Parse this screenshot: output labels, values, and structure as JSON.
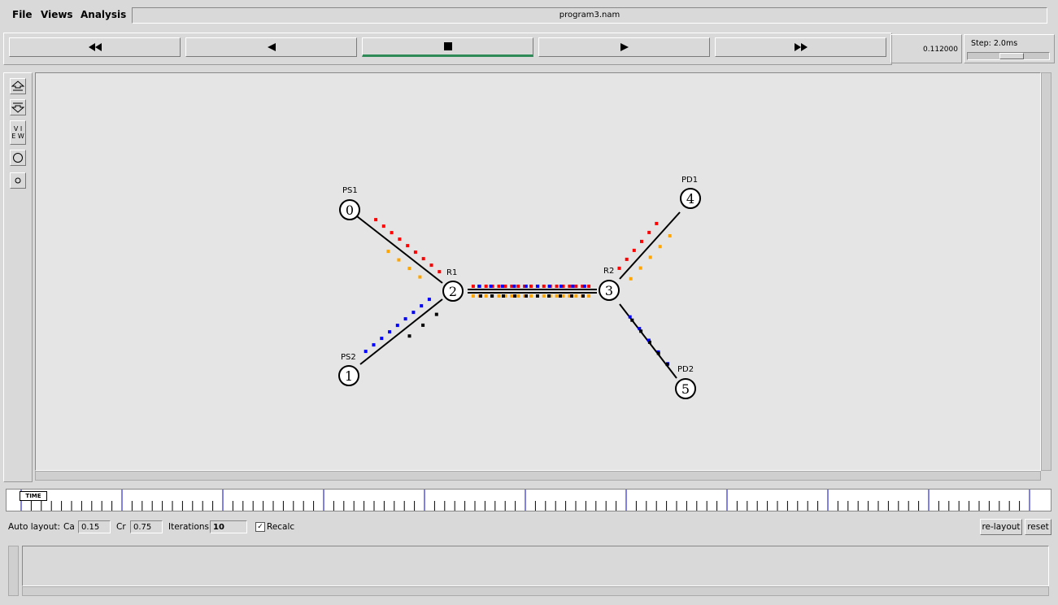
{
  "menu": {
    "file": "File",
    "views": "Views",
    "analysis": "Analysis"
  },
  "window_title": "program3.nam",
  "playback": {
    "buttons": [
      {
        "name": "fast-rewind",
        "icon": "double-left-triangle-icon"
      },
      {
        "name": "rewind",
        "icon": "left-triangle-icon"
      },
      {
        "name": "stop",
        "icon": "square-stop-icon",
        "active": true
      },
      {
        "name": "play",
        "icon": "right-triangle-icon"
      },
      {
        "name": "fast-forward",
        "icon": "double-right-triangle-icon"
      }
    ],
    "time": "0.112000",
    "step_label": "Step: 2.0ms"
  },
  "toolbar": {
    "view_label_1": "V I",
    "view_label_2": "E W"
  },
  "nodes": [
    {
      "id": "0",
      "label": "PS1"
    },
    {
      "id": "1",
      "label": "PS2"
    },
    {
      "id": "2",
      "label": "R1"
    },
    {
      "id": "3",
      "label": "R2"
    },
    {
      "id": "4",
      "label": "PD1"
    },
    {
      "id": "5",
      "label": "PD2"
    }
  ],
  "colors": {
    "red": "#ff0000",
    "orange": "#ffa500",
    "blue": "#0000ff",
    "black": "#000000",
    "active_bar": "#2e8b57",
    "canvas": "#e5e5e5"
  },
  "timeline": {
    "tag": "TIME"
  },
  "autolayout": {
    "label": "Auto layout:",
    "ca_label": "Ca",
    "ca_value": "0.15",
    "cr_label": "Cr",
    "cr_value": "0.75",
    "iterations_label": "Iterations",
    "iterations_value": "10",
    "recalc_label": "Recalc",
    "recalc_checked": "✓",
    "relayout_label": "re-layout",
    "reset_label": "reset"
  }
}
